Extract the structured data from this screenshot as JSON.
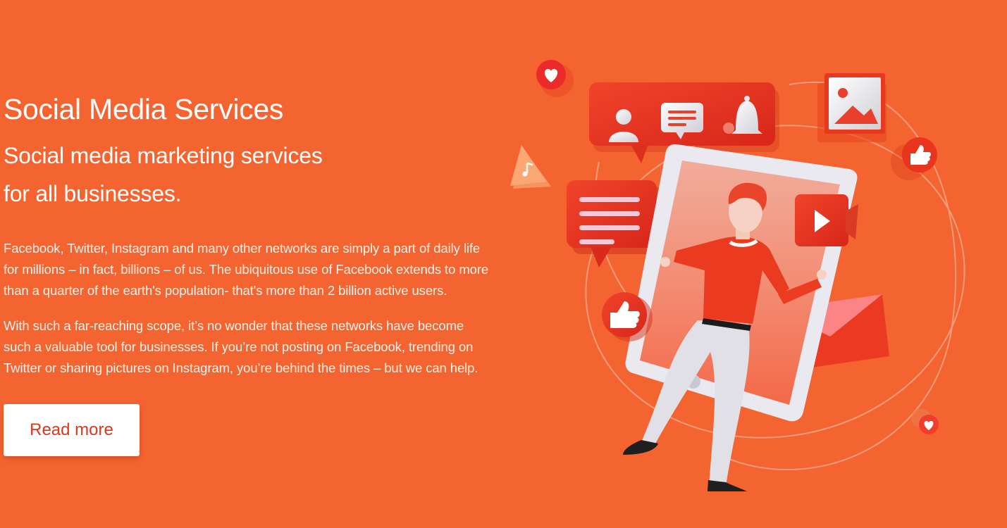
{
  "hero": {
    "title": "Social Media Services",
    "subtitle_line1": "Social media marketing services",
    "subtitle_line2": "for all businesses.",
    "paragraph1_line1": "Facebook, Twitter, Instagram and many other networks are simply a part of daily life",
    "paragraph1_line2": "for millions – in fact, billions – of us. The ubiquitous use of Facebook extends to more",
    "paragraph1_line3": "than a quarter of the earth's population- that's more than 2 billion active users.",
    "paragraph2_line1": "With such a far-reaching scope, it’s no wonder that these networks have become",
    "paragraph2_line2": "such a valuable tool for businesses. If you’re not posting on Facebook, trending on",
    "paragraph2_line3": "Twitter or sharing pictures on Instagram, you’re behind the times – but we can help.",
    "read_more_label": "Read more"
  },
  "colors": {
    "background": "#f46431",
    "accent": "#e0361c",
    "button_bg": "#ffffff"
  },
  "illustration": {
    "icons": [
      "heart-icon",
      "user-icon",
      "chat-icon",
      "bell-icon",
      "image-icon",
      "thumbs-up-icon",
      "music-note-icon",
      "message-icon",
      "play-icon",
      "envelope-icon",
      "smartphone-icon",
      "person-figure"
    ]
  }
}
